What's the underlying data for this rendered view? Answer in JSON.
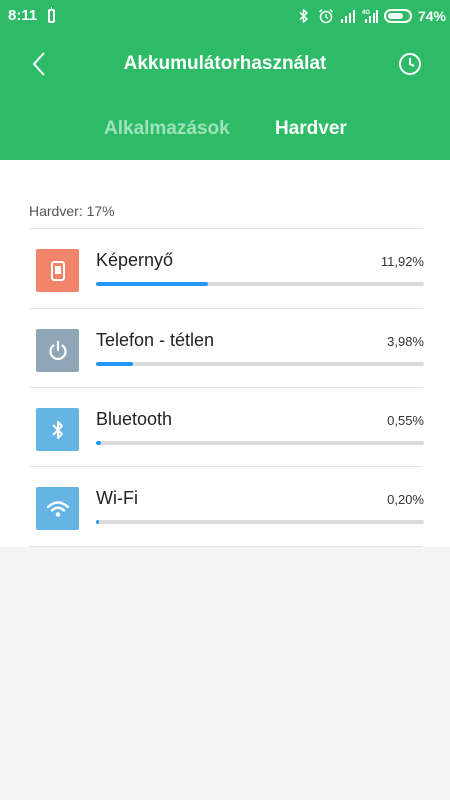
{
  "status_bar": {
    "time": "8:11",
    "battery_percent": "74%",
    "battery_level": 0.74,
    "icons": [
      "battery-saver-icon",
      "bluetooth-icon",
      "alarm-icon",
      "signal-icon",
      "4g-signal-icon",
      "battery-icon"
    ]
  },
  "header": {
    "title": "Akkumulátorhasználat",
    "back_icon": "chevron-left-icon",
    "history_icon": "clock-icon"
  },
  "tabs": [
    {
      "label": "Alkalmazások",
      "active": false
    },
    {
      "label": "Hardver",
      "active": true
    }
  ],
  "section_label": "Hardver: 17%",
  "items": [
    {
      "name": "Képernyő",
      "percent": "11,92%",
      "value": 11.92,
      "icon": "screen-icon",
      "icon_color": "#f2846a"
    },
    {
      "name": "Telefon - tétlen",
      "percent": "3,98%",
      "value": 3.98,
      "icon": "power-icon",
      "icon_color": "#8ea6b7"
    },
    {
      "name": "Bluetooth",
      "percent": "0,55%",
      "value": 0.55,
      "icon": "bluetooth-icon",
      "icon_color": "#64b5e6"
    },
    {
      "name": "Wi-Fi",
      "percent": "0,20%",
      "value": 0.2,
      "icon": "wifi-icon",
      "icon_color": "#64b5e6"
    }
  ],
  "colors": {
    "header_bg": "#2ebb67",
    "progress_fill": "#2196f3",
    "progress_track": "#dcdcdc"
  }
}
